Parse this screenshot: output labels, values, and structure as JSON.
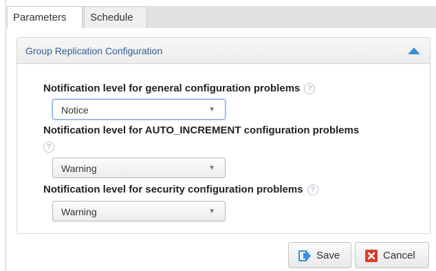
{
  "tabs": [
    {
      "label": "Parameters",
      "active": true
    },
    {
      "label": "Schedule",
      "active": false
    }
  ],
  "panel": {
    "title": "Group Replication Configuration",
    "collapse_icon": "triangle-up-icon"
  },
  "fields": [
    {
      "label": "Notification level for general configuration problems",
      "value": "Notice"
    },
    {
      "label": "Notification level for AUTO_INCREMENT configuration problems",
      "value": "Warning"
    },
    {
      "label": "Notification level for security configuration problems",
      "value": "Warning"
    }
  ],
  "help_glyph": "?",
  "caret_glyph": "▼",
  "buttons": {
    "save_label": "Save",
    "cancel_label": "Cancel"
  },
  "colors": {
    "accent": "#2f5f96",
    "save_icon": "#3a8fd6",
    "cancel_icon": "#d93a2b"
  }
}
